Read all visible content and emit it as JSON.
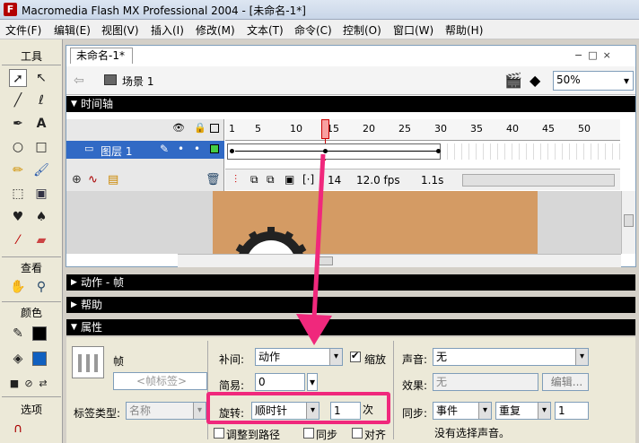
{
  "window": {
    "title": "Macromedia Flash MX Professional 2004 - [未命名-1*]",
    "logo": "F"
  },
  "menu": [
    "文件(F)",
    "编辑(E)",
    "视图(V)",
    "插入(I)",
    "修改(M)",
    "文本(T)",
    "命令(C)",
    "控制(O)",
    "窗口(W)",
    "帮助(H)"
  ],
  "tools": {
    "title": "工具",
    "view_title": "查看",
    "color_title": "颜色",
    "options_title": "选项"
  },
  "doc": {
    "tab": "未命名-1*",
    "scene": "场景 1",
    "zoom": "50%"
  },
  "timeline": {
    "title": "时间轴",
    "layer": "图层 1",
    "ticks": [
      "1",
      "5",
      "10",
      "15",
      "20",
      "25",
      "30",
      "35",
      "40",
      "45",
      "50"
    ],
    "current_frame": "14",
    "fps": "12.0 fps",
    "time": "1.1s"
  },
  "panels": {
    "actions": "动作 - 帧",
    "help": "帮助",
    "properties": "属性"
  },
  "props": {
    "frame_label": "帧",
    "frame_placeholder": "<帧标签>",
    "label_type_label": "标签类型:",
    "label_type_value": "名称",
    "tween_label": "补间:",
    "tween_value": "动作",
    "scale_label": "缩放",
    "ease_label": "简易:",
    "ease_value": "0",
    "rotate_label": "旋转:",
    "rotate_value": "顺时针",
    "rotate_times": "1",
    "times_label": "次",
    "orient_label": "调整到路径",
    "sync_label": "同步",
    "snap_label": "对齐",
    "sound_label": "声音:",
    "sound_value": "无",
    "effect_label": "效果:",
    "effect_value": "无",
    "edit_button": "编辑...",
    "sync2_label": "同步:",
    "sync2_value": "事件",
    "repeat_label": "重复",
    "repeat_value": "1",
    "no_sound": "没有选择声音。"
  },
  "colors": {
    "highlight": "#f0287c",
    "stage": "#d49b64"
  }
}
